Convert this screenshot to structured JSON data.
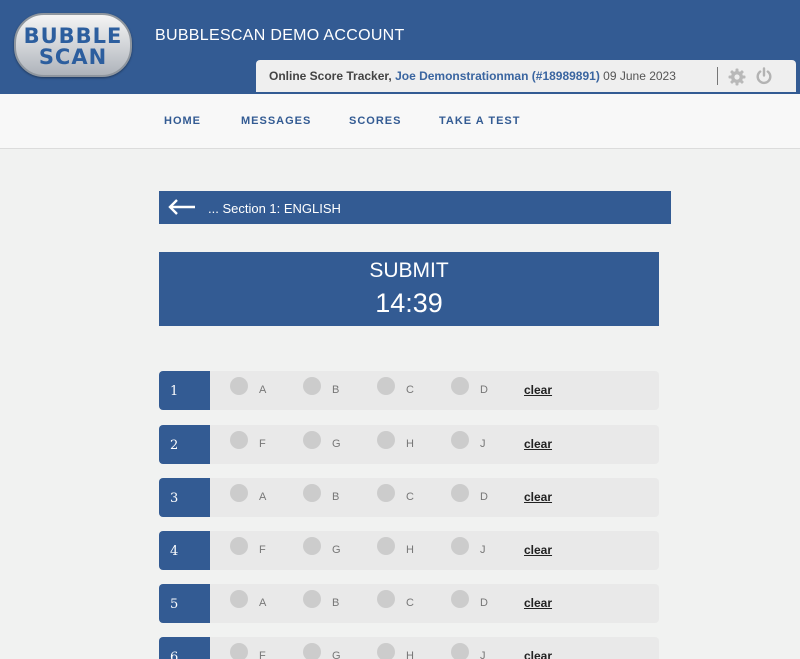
{
  "logo": {
    "line1": "BUBBLE",
    "line2": "SCAN"
  },
  "account_title": "BUBBLESCAN DEMO ACCOUNT",
  "tracker": {
    "label": "Online Score Tracker,",
    "user": "Joe Demonstrationman (#18989891)",
    "date": "09 June 2023"
  },
  "nav": [
    "HOME",
    "MESSAGES",
    "SCORES",
    "TAKE A TEST"
  ],
  "section_title": "... Section 1: ENGLISH",
  "submit_label": "SUBMIT",
  "timer": "14:39",
  "clear_label": "clear",
  "questions": [
    {
      "num": "1",
      "options": [
        "A",
        "B",
        "C",
        "D"
      ]
    },
    {
      "num": "2",
      "options": [
        "F",
        "G",
        "H",
        "J"
      ]
    },
    {
      "num": "3",
      "options": [
        "A",
        "B",
        "C",
        "D"
      ]
    },
    {
      "num": "4",
      "options": [
        "F",
        "G",
        "H",
        "J"
      ]
    },
    {
      "num": "5",
      "options": [
        "A",
        "B",
        "C",
        "D"
      ]
    },
    {
      "num": "6",
      "options": [
        "F",
        "G",
        "H",
        "J"
      ]
    }
  ],
  "colors": {
    "primary": "#335b93",
    "row_bg": "#e9e9e9",
    "bubble": "#cccccc"
  },
  "icons": {
    "settings": "gear-icon",
    "logout": "power-icon",
    "back": "back-arrow-icon"
  }
}
